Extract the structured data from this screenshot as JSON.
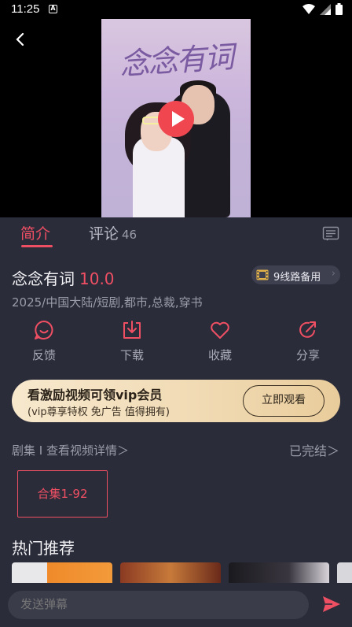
{
  "status_bar": {
    "time": "11:25",
    "notification_badge": "A"
  },
  "player": {
    "poster_title": "念念有词"
  },
  "tabs": {
    "intro_label": "简介",
    "comments_label": "评论",
    "comments_count": "46"
  },
  "show": {
    "title": "念念有词",
    "score": "10.0",
    "lines_label": "9线路备用",
    "meta": "2025/中国大陆/短剧,都市,总裁,穿书"
  },
  "actions": [
    {
      "label": "反馈",
      "icon": "feedback-icon"
    },
    {
      "label": "下载",
      "icon": "download-icon"
    },
    {
      "label": "收藏",
      "icon": "heart-icon"
    },
    {
      "label": "分享",
      "icon": "share-icon"
    }
  ],
  "vip_banner": {
    "title": "看激励视频可领vip会员",
    "subtitle": "(vip尊享特权 免广告 值得拥有)",
    "button_label": "立即观看"
  },
  "episodes": {
    "header": "剧集 I 查看视频详情＞",
    "status": "已完结＞",
    "items": [
      "合集1-92"
    ]
  },
  "hot": {
    "title": "热门推荐"
  },
  "danmu": {
    "placeholder": "发送弹幕"
  },
  "colors": {
    "accent": "#ef4f63",
    "background": "#2a2c3a",
    "vip_gold": "#f1dbb5"
  }
}
